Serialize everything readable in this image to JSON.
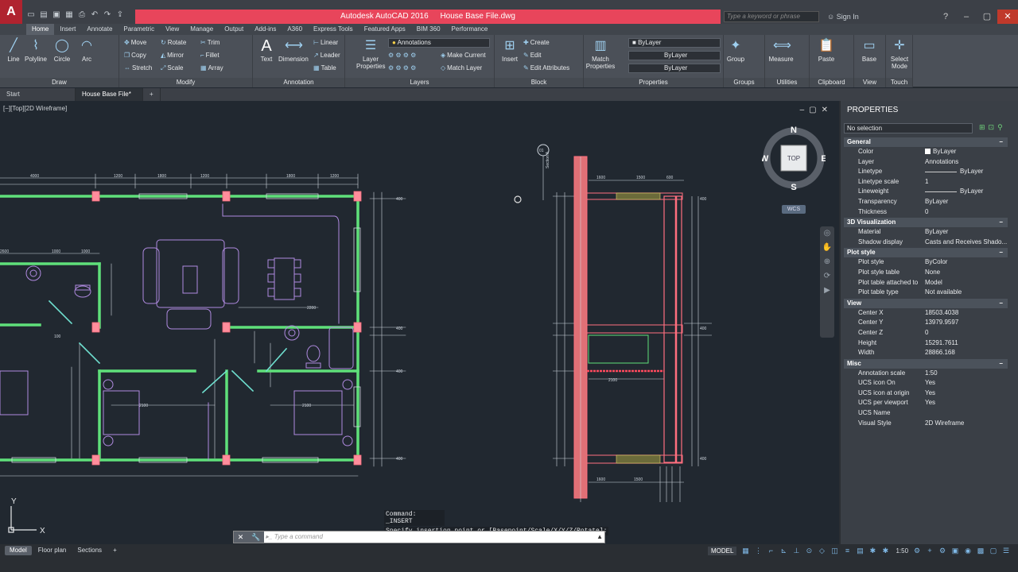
{
  "app": {
    "logo": "A",
    "title": "Autodesk AutoCAD 2016",
    "filename": "House Base File.dwg",
    "search_placeholder": "Type a keyword or phrase",
    "signin": "Sign In"
  },
  "ribbon_tabs": [
    "Home",
    "Insert",
    "Annotate",
    "Parametric",
    "View",
    "Manage",
    "Output",
    "Add-ins",
    "A360",
    "Express Tools",
    "Featured Apps",
    "BIM 360",
    "Performance"
  ],
  "ribbon": {
    "draw": {
      "label": "Draw",
      "line": "Line",
      "polyline": "Polyline",
      "circle": "Circle",
      "arc": "Arc"
    },
    "modify": {
      "label": "Modify",
      "move": "Move",
      "rotate": "Rotate",
      "trim": "Trim",
      "copy": "Copy",
      "mirror": "Mirror",
      "fillet": "Fillet",
      "stretch": "Stretch",
      "scale": "Scale",
      "array": "Array"
    },
    "annotation": {
      "label": "Annotation",
      "text": "Text",
      "dimension": "Dimension",
      "linear": "Linear",
      "leader": "Leader",
      "table": "Table"
    },
    "layers": {
      "label": "Layers",
      "layer_properties_1": "Layer",
      "layer_properties_2": "Properties",
      "current_layer": "Annotations",
      "make_current": "Make Current",
      "match_layer": "Match Layer"
    },
    "block": {
      "label": "Block",
      "insert": "Insert",
      "create": "Create",
      "edit": "Edit",
      "edit_attributes": "Edit Attributes"
    },
    "properties": {
      "label": "Properties",
      "match_1": "Match",
      "match_2": "Properties",
      "color": "ByLayer",
      "linetype": "ByLayer",
      "lineweight": "ByLayer"
    },
    "groups": {
      "label": "Groups",
      "group": "Group"
    },
    "utilities": {
      "label": "Utilities",
      "measure": "Measure"
    },
    "clipboard": {
      "label": "Clipboard",
      "paste": "Paste"
    },
    "view": {
      "label": "View",
      "base": "Base"
    },
    "touch": {
      "label": "Touch",
      "select_1": "Select",
      "select_2": "Mode"
    }
  },
  "doc_tabs": [
    "Start",
    "House Base File*"
  ],
  "viewport": {
    "label": "[−][Top][2D Wireframe]",
    "viewcube": {
      "n": "N",
      "s": "S",
      "e": "E",
      "w": "W",
      "face": "TOP",
      "ucs": "WCS"
    },
    "section_label": "Section A",
    "section_tag": "01"
  },
  "command": {
    "history_1": "Command: _INSERT",
    "history_2": "Specify insertion point or [Basepoint/Scale/X/Y/Z/Rotate]:",
    "placeholder": "Type a command"
  },
  "properties_palette": {
    "title": "PROPERTIES",
    "selection": "No selection",
    "sections": [
      {
        "name": "General",
        "rows": [
          {
            "k": "Color",
            "v": "ByLayer"
          },
          {
            "k": "Layer",
            "v": "Annotations"
          },
          {
            "k": "Linetype",
            "v": "ByLayer"
          },
          {
            "k": "Linetype scale",
            "v": "1"
          },
          {
            "k": "Lineweight",
            "v": "ByLayer"
          },
          {
            "k": "Transparency",
            "v": "ByLayer"
          },
          {
            "k": "Thickness",
            "v": "0"
          }
        ]
      },
      {
        "name": "3D Visualization",
        "rows": [
          {
            "k": "Material",
            "v": "ByLayer"
          },
          {
            "k": "Shadow display",
            "v": "Casts and Receives Shado..."
          }
        ]
      },
      {
        "name": "Plot style",
        "rows": [
          {
            "k": "Plot style",
            "v": "ByColor"
          },
          {
            "k": "Plot style table",
            "v": "None"
          },
          {
            "k": "Plot table attached to",
            "v": "Model"
          },
          {
            "k": "Plot table type",
            "v": "Not available"
          }
        ]
      },
      {
        "name": "View",
        "rows": [
          {
            "k": "Center X",
            "v": "18503.4038"
          },
          {
            "k": "Center Y",
            "v": "13979.9597"
          },
          {
            "k": "Center Z",
            "v": "0"
          },
          {
            "k": "Height",
            "v": "15291.7611"
          },
          {
            "k": "Width",
            "v": "28866.168"
          }
        ]
      },
      {
        "name": "Misc",
        "rows": [
          {
            "k": "Annotation scale",
            "v": "1:50"
          },
          {
            "k": "UCS icon On",
            "v": "Yes"
          },
          {
            "k": "UCS icon at origin",
            "v": "Yes"
          },
          {
            "k": "UCS per viewport",
            "v": "Yes"
          },
          {
            "k": "UCS Name",
            "v": ""
          },
          {
            "k": "Visual Style",
            "v": "2D Wireframe"
          }
        ]
      }
    ]
  },
  "layout_tabs": [
    "Model",
    "Floor plan",
    "Sections"
  ],
  "status": {
    "model": "MODEL",
    "scale": "1:50"
  },
  "ucs": {
    "x": "X",
    "y": "Y"
  },
  "colors": {
    "accent": "#e8455b",
    "wall": "#5fe07a",
    "pink": "#ff6f7f",
    "linework": "#b08ae0",
    "dim": "#cfd6de"
  }
}
